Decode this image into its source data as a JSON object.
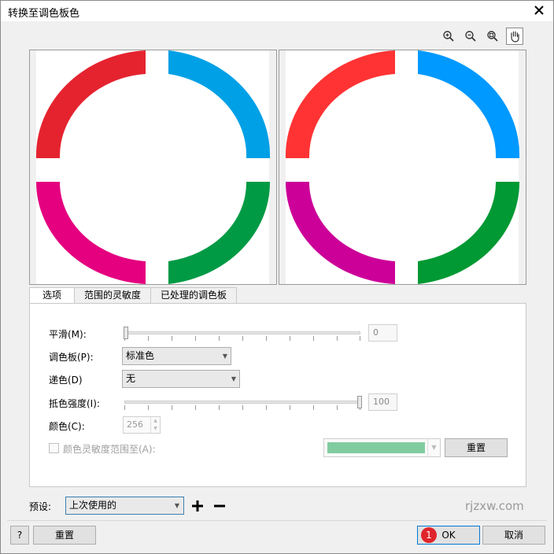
{
  "window": {
    "title": "转换至调色板色",
    "close_icon": "close-icon"
  },
  "toolbar": {
    "icons": [
      "zoom-in-icon",
      "zoom-out-icon",
      "zoom-fit-icon",
      "pan-hand-icon"
    ]
  },
  "preview": {
    "original_colors": [
      "#e5232f",
      "#00a0e6",
      "#e4007f",
      "#009a45"
    ],
    "converted_colors": [
      "#ff3333",
      "#0099ff",
      "#cc0099",
      "#009933"
    ]
  },
  "tabs": [
    "选项",
    "范围的灵敏度",
    "已处理的调色板"
  ],
  "options": {
    "smooth_label": "平滑(M):",
    "smooth_value": "0",
    "palette_label": "调色板(P):",
    "palette_value": "标准色",
    "dither_label": "递色(D)",
    "dither_value": "无",
    "dither_intensity_label": "抵色强度(I):",
    "dither_intensity_value": "100",
    "colors_label": "颜色(C):",
    "colors_value": "256",
    "sensitivity_label": "颜色灵敏度范围至(A):",
    "sensitivity_color": "#80cca0",
    "reset_label": "重置"
  },
  "preset": {
    "label": "预设:",
    "value": "上次使用的",
    "add": "+",
    "remove": "−"
  },
  "watermark": "rjzxw.com",
  "footer": {
    "help": "?",
    "reset": "重置",
    "badge": "1",
    "ok": "OK",
    "cancel": "取消"
  }
}
